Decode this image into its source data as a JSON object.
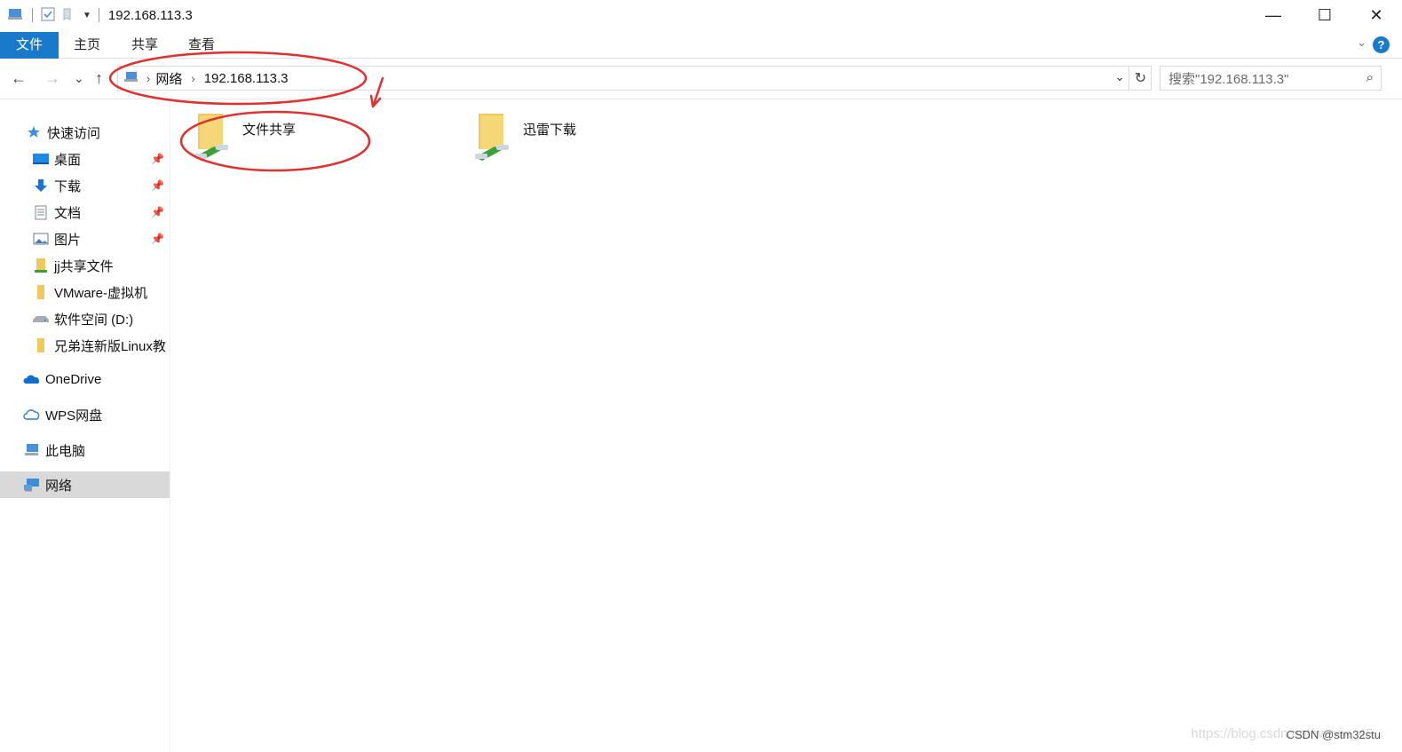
{
  "window": {
    "title": "192.168.113.3",
    "minimize": "—",
    "maximize": "☐",
    "close": "✕"
  },
  "ribbon": {
    "tabs": [
      "文件",
      "主页",
      "共享",
      "查看"
    ],
    "help": "?"
  },
  "nav": {
    "back": "←",
    "forward": "→",
    "recent": "⌄",
    "up": "↑"
  },
  "address": {
    "crumbs": [
      "网络",
      "192.168.113.3"
    ],
    "search_placeholder": "搜索\"192.168.113.3\""
  },
  "sidebar": {
    "items": [
      {
        "label": "快速访问",
        "icon": "star-icon"
      },
      {
        "label": "桌面",
        "icon": "desktop-icon",
        "pinned": true
      },
      {
        "label": "下载",
        "icon": "download-icon",
        "pinned": true
      },
      {
        "label": "文档",
        "icon": "document-icon",
        "pinned": true
      },
      {
        "label": "图片",
        "icon": "picture-icon",
        "pinned": true
      },
      {
        "label": "jj共享文件",
        "icon": "shared-folder-icon"
      },
      {
        "label": "VMware-虚拟机",
        "icon": "folder-icon"
      },
      {
        "label": "软件空间 (D:)",
        "icon": "drive-icon"
      },
      {
        "label": "兄弟连新版Linux教",
        "icon": "folder-icon"
      },
      {
        "label": "OneDrive",
        "icon": "onedrive-icon"
      },
      {
        "label": "WPS网盘",
        "icon": "cloud-icon"
      },
      {
        "label": "此电脑",
        "icon": "computer-icon"
      },
      {
        "label": "网络",
        "icon": "network-icon",
        "selected": true
      }
    ]
  },
  "content": {
    "items": [
      {
        "label": "文件共享",
        "icon": "network-share-folder-icon"
      },
      {
        "label": "迅雷下载",
        "icon": "network-share-folder-icon"
      }
    ]
  },
  "watermark": {
    "url": "https://blog.csdn.net/weixin_45...",
    "credit": "CSDN @stm32stu"
  },
  "colors": {
    "accent": "#1979ca",
    "annotation": "#e03030",
    "folder": "#f0c95c",
    "network_pipe": "#3aa03a"
  }
}
